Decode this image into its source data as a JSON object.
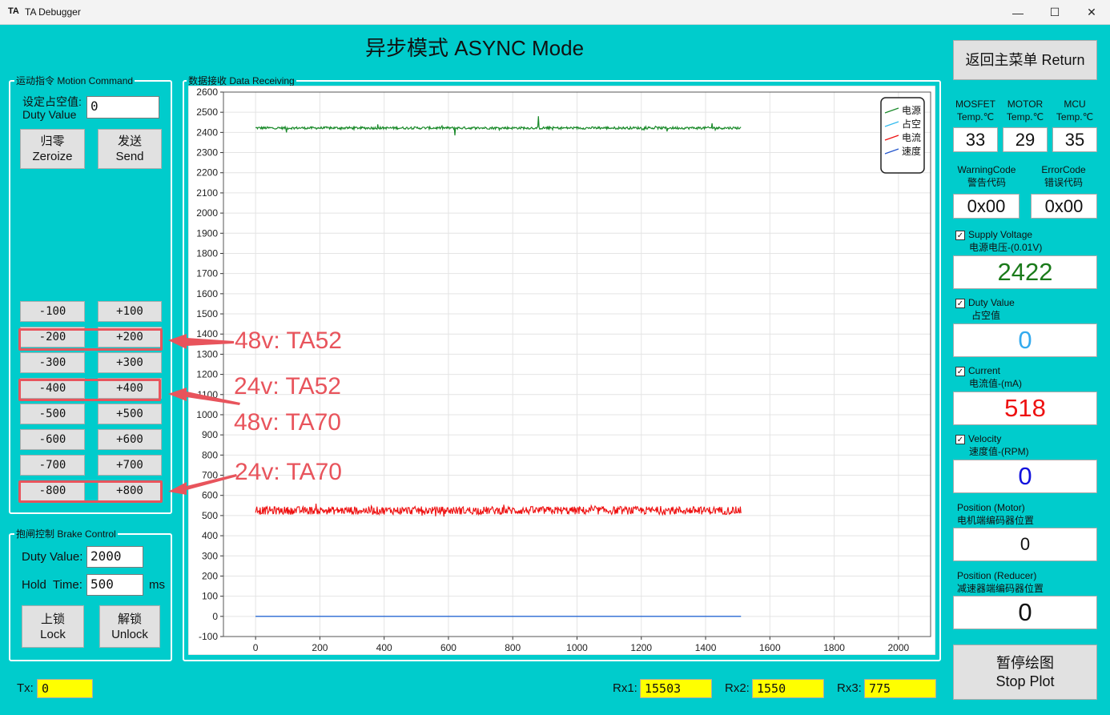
{
  "window": {
    "logo": "TA",
    "title": "TA Debugger",
    "min_icon": "minimize-icon",
    "max_icon": "maximize-icon",
    "close_icon": "close-icon"
  },
  "heading": "异步模式 ASYNC Mode",
  "return_button": "返回主菜单 Return",
  "motion": {
    "label": "运动指令 Motion Command",
    "duty_label_1": "设定占空值:",
    "duty_label_2": "Duty Value",
    "duty_value": "0",
    "zeroize_1": "归零",
    "zeroize_2": "Zeroize",
    "send_1": "发送",
    "send_2": "Send",
    "neg": [
      "-100",
      "-200",
      "-300",
      "-400",
      "-500",
      "-600",
      "-700",
      "-800"
    ],
    "pos": [
      "+100",
      "+200",
      "+300",
      "+400",
      "+500",
      "+600",
      "+700",
      "+800"
    ]
  },
  "brake": {
    "label": "抱闸控制 Brake Control",
    "duty_label": "Duty Value:",
    "duty_value": "2000",
    "hold_label": "Hold  Time:",
    "hold_value": "500",
    "hold_unit": "ms",
    "lock_1": "上锁",
    "lock_2": "Lock",
    "unlock_1": "解锁",
    "unlock_2": "Unlock"
  },
  "data_label": "数据接收 Data Receiving",
  "annotations": [
    "48v: TA52",
    "24v: TA52",
    "48v: TA70",
    "24v: TA70"
  ],
  "status": {
    "mosfet_1": "MOSFET",
    "mosfet_2": "Temp.℃",
    "mosfet_val": "33",
    "motor_1": "MOTOR",
    "motor_2": "Temp.℃",
    "motor_val": "29",
    "mcu_1": "MCU",
    "mcu_2": "Temp.℃",
    "mcu_val": "35",
    "warn_1": "WarningCode",
    "warn_2": "警告代码",
    "warn_val": "0x00",
    "err_1": "ErrorCode",
    "err_2": "错误代码",
    "err_val": "0x00",
    "supply_1": "Supply Voltage",
    "supply_2": "电源电压-(0.01V)",
    "supply_val": "2422",
    "supply_color": "#1a7a1a",
    "duty_1": "Duty Value",
    "duty_2": "占空值",
    "duty_val": "0",
    "duty_color": "#33aaee",
    "current_1": "Current",
    "current_2": "电流值-(mA)",
    "current_val": "518",
    "current_color": "#ee1111",
    "vel_1": "Velocity",
    "vel_2": "速度值-(RPM)",
    "vel_val": "0",
    "vel_color": "#1111dd",
    "posm_1": "Position (Motor)",
    "posm_2": "电机端编码器位置",
    "posm_val": "0",
    "posr_1": "Position (Reducer)",
    "posr_2": "减速器端编码器位置",
    "posr_val": "0",
    "check_mark": "✓"
  },
  "stop_plot_1": "暂停绘图",
  "stop_plot_2": "Stop Plot",
  "footer": {
    "tx_label": "Tx:",
    "tx_val": "0",
    "rx1_label": "Rx1:",
    "rx1_val": "15503",
    "rx2_label": "Rx2:",
    "rx2_val": "1550",
    "rx3_label": "Rx3:",
    "rx3_val": "775"
  },
  "chart_data": {
    "type": "line",
    "title": "",
    "xlabel": "",
    "ylabel": "",
    "xlim": [
      -100,
      2100
    ],
    "ylim": [
      -100,
      2600
    ],
    "x_ticks": [
      0,
      200,
      400,
      600,
      800,
      1000,
      1200,
      1400,
      1600,
      1800,
      2000
    ],
    "y_ticks": [
      -100,
      0,
      100,
      200,
      300,
      400,
      500,
      600,
      700,
      800,
      900,
      1000,
      1100,
      1200,
      1300,
      1400,
      1500,
      1600,
      1700,
      1800,
      1900,
      2000,
      2100,
      2200,
      2300,
      2400,
      2500,
      2600
    ],
    "grid": true,
    "legend_position": "top-right",
    "series": [
      {
        "name": "电源",
        "color": "#1a8a2a",
        "x_range": [
          0,
          1510
        ],
        "approx_value": 2422,
        "noise": 6,
        "spikes": [
          [
            380,
            2440
          ],
          [
            620,
            2385
          ],
          [
            880,
            2480
          ],
          [
            1280,
            2405
          ],
          [
            1420,
            2445
          ],
          [
            95,
            2400
          ]
        ]
      },
      {
        "name": "占空",
        "color": "#33bbee",
        "x_range": [
          0,
          1510
        ],
        "approx_value": 0,
        "noise": 0,
        "spikes": []
      },
      {
        "name": "电流",
        "color": "#ee1111",
        "x_range": [
          0,
          1510
        ],
        "approx_value": 525,
        "noise": 20,
        "spikes": []
      },
      {
        "name": "速度",
        "color": "#2255cc",
        "x_range": [
          0,
          1510
        ],
        "approx_value": 0,
        "noise": 0,
        "spikes": []
      }
    ]
  }
}
